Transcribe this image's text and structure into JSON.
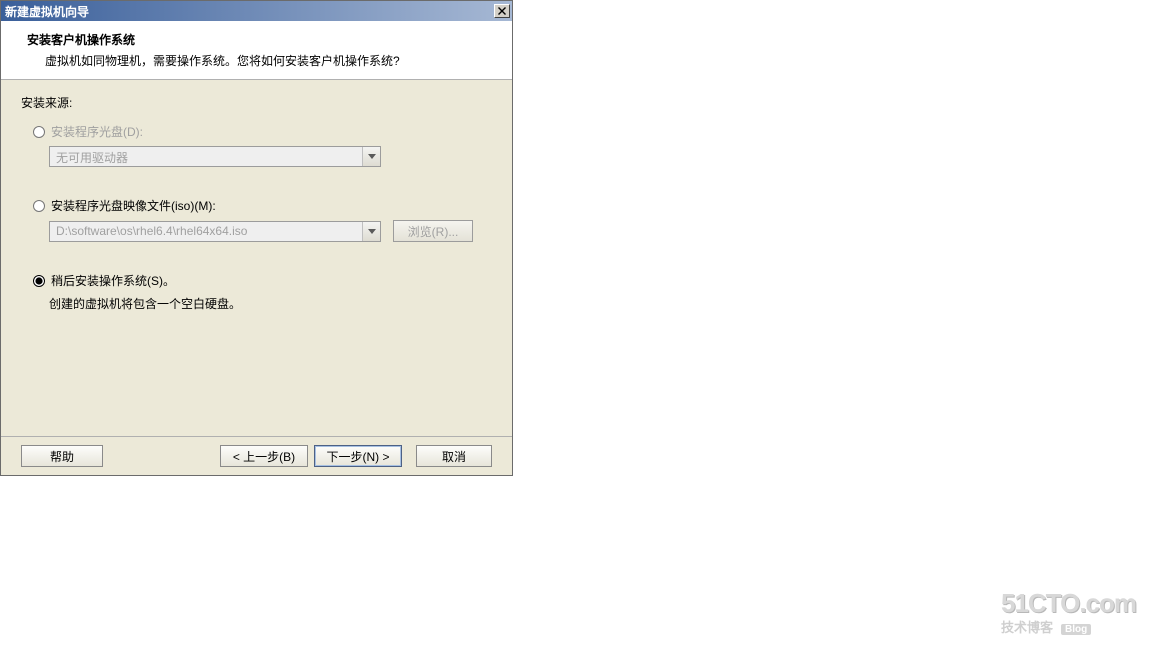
{
  "dialog": {
    "title": "新建虚拟机向导",
    "header": {
      "title": "安装客户机操作系统",
      "description": "虚拟机如同物理机，需要操作系统。您将如何安装客户机操作系统?"
    },
    "source_label": "安装来源:",
    "option_disc": {
      "label": "安装程序光盘(D):",
      "dropdown_value": "无可用驱动器"
    },
    "option_iso": {
      "label": "安装程序光盘映像文件(iso)(M):",
      "path_value": "D:\\software\\os\\rhel6.4\\rhel64x64.iso",
      "browse_label": "浏览(R)..."
    },
    "option_later": {
      "label": "稍后安装操作系统(S)。",
      "hint": "创建的虚拟机将包含一个空白硬盘。"
    },
    "selected_option": "later",
    "footer": {
      "help": "帮助",
      "back": "< 上一步(B)",
      "next": "下一步(N) >",
      "cancel": "取消"
    }
  },
  "watermark": {
    "logo": "51CTO.com",
    "subtitle": "技术博客",
    "badge": "Blog"
  }
}
